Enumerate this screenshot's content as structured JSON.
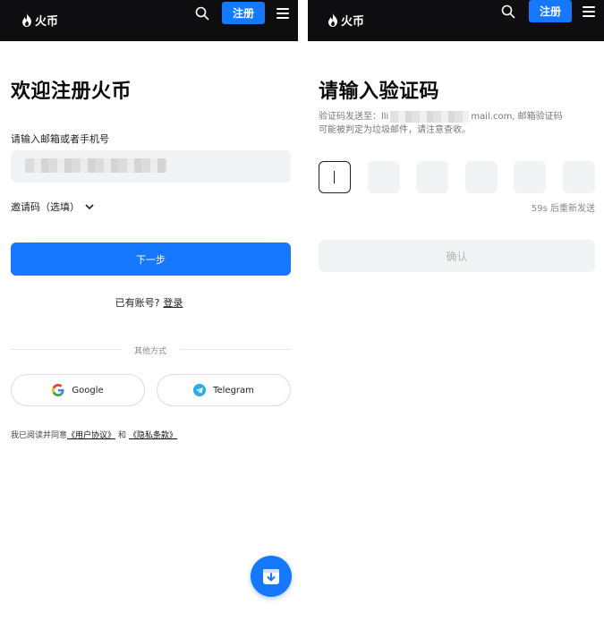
{
  "brand": {
    "name": "火币",
    "accent": "#1677ff",
    "topbar_bg": "#0e0e10"
  },
  "header": {
    "register_label": "注册"
  },
  "left": {
    "title": "欢迎注册火币",
    "account_label": "请输入邮箱或者手机号",
    "invite_label": "邀请码（选填）",
    "next_button": "下一步",
    "has_account_text": "已有账号?",
    "login_link": "登录",
    "other_methods": "其他方式",
    "google_label": "Google",
    "telegram_label": "Telegram",
    "agreement_prefix": "我已阅读并同意",
    "user_agreement": "《用户协议》",
    "and_text": "和",
    "privacy_policy": "《隐私条款》"
  },
  "right": {
    "title": "请输入验证码",
    "sent_prefix": "验证码发送至：",
    "sent_email_partial": "lli",
    "sent_email_suffix": "mail.com, 邮箱验证码",
    "sent_line2": "可能被判定为垃圾邮件，请注意查收。",
    "resend_text": "59s 后重新发送",
    "confirm_button": "确认"
  },
  "icons": [
    "search-icon",
    "menu-icon",
    "chevron-down-icon",
    "google-icon",
    "telegram-icon",
    "download-icon",
    "logo-flame-icon"
  ]
}
